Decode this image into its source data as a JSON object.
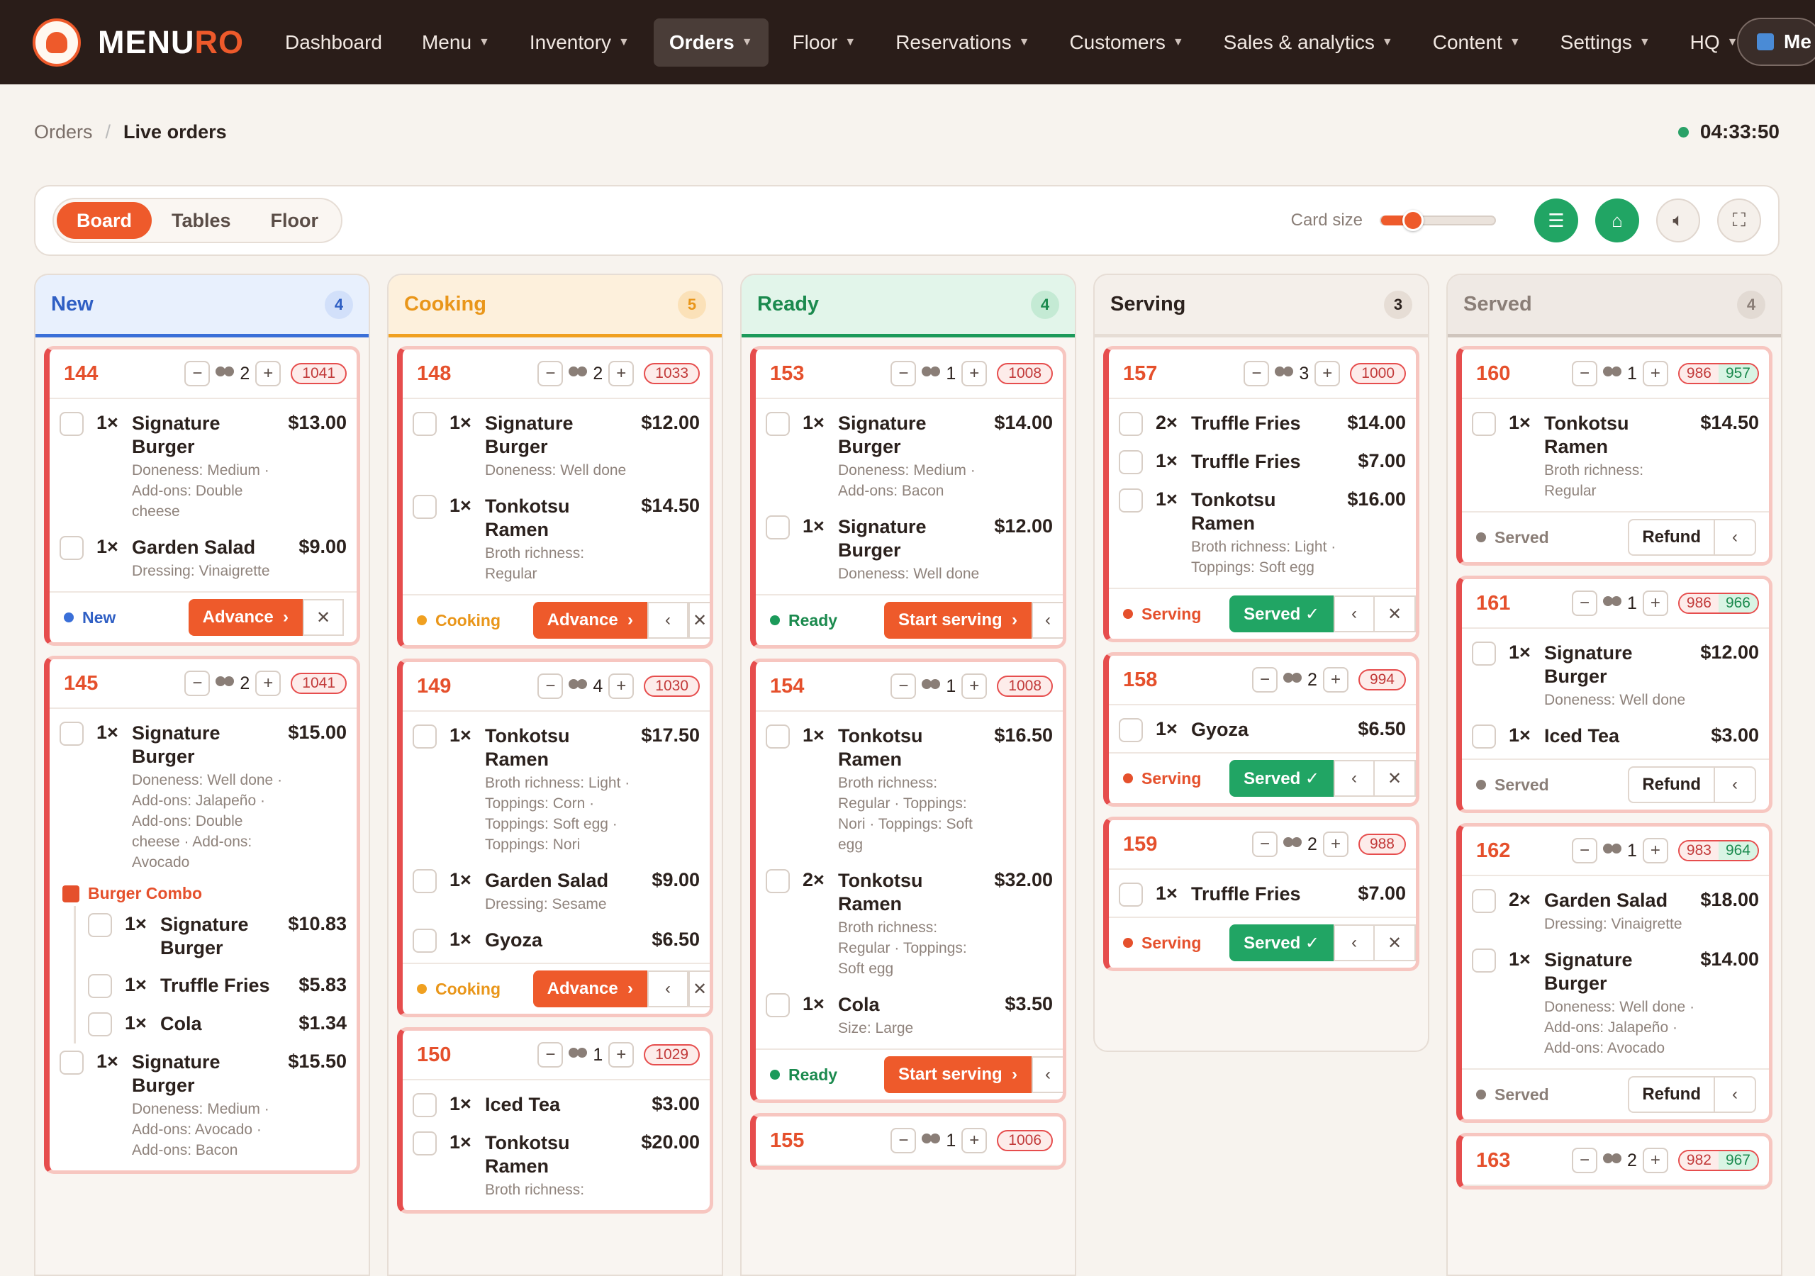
{
  "brand": {
    "name_main": "MENU",
    "name_accent": "RO"
  },
  "nav": {
    "items": [
      "Dashboard",
      "Menu",
      "Inventory",
      "Orders",
      "Floor",
      "Reservations",
      "Customers",
      "Sales & analytics",
      "Content",
      "Settings",
      "HQ"
    ],
    "active": "Orders",
    "hq_switch_label": "Me"
  },
  "breadcrumb": {
    "parent": "Orders",
    "separator": "/",
    "current": "Live orders"
  },
  "clock": "04:33:50",
  "toolbar": {
    "views": [
      "Board",
      "Tables",
      "Floor"
    ],
    "active_view": "Board",
    "card_size_label": "Card size",
    "card_size_value": 0.28
  },
  "columns": [
    {
      "title": "New",
      "count": "4",
      "color": "#3a6fd8"
    },
    {
      "title": "Cooking",
      "count": "5",
      "color": "#f0a020"
    },
    {
      "title": "Ready",
      "count": "4",
      "color": "#1b9a5a"
    },
    {
      "title": "Serving",
      "count": "3",
      "color": "#2b211d"
    },
    {
      "title": "Served",
      "count": "4",
      "color": "#8a7e77"
    }
  ],
  "labels": {
    "advance": "Advance",
    "start_serving": "Start serving",
    "served_btn": "Served ✓",
    "refund": "Refund",
    "status_new": "New",
    "status_cooking": "Cooking",
    "status_ready": "Ready",
    "status_serving": "Serving",
    "status_served": "Served",
    "combo_name": "Burger Combo"
  },
  "orders": {
    "o144": {
      "no": "144",
      "guests": "2",
      "tag": "1041",
      "items": [
        {
          "q": "1×",
          "n": "Signature Burger",
          "m": "Doneness: Medium · Add-ons: Double cheese",
          "p": "$13.00"
        },
        {
          "q": "1×",
          "n": "Garden Salad",
          "m": "Dressing: Vinaigrette",
          "p": "$9.00"
        }
      ]
    },
    "o145": {
      "no": "145",
      "guests": "2",
      "tag": "1041",
      "items": [
        {
          "q": "1×",
          "n": "Signature Burger",
          "m": "Doneness: Well done · Add-ons: Jalapeño · Add-ons: Double cheese · Add-ons: Avocado",
          "p": "$15.00"
        },
        {
          "q": "1×",
          "n": "Signature Burger",
          "m": "",
          "p": "$10.83"
        },
        {
          "q": "1×",
          "n": "Truffle Fries",
          "m": "",
          "p": "$5.83"
        },
        {
          "q": "1×",
          "n": "Cola",
          "m": "",
          "p": "$1.34"
        },
        {
          "q": "1×",
          "n": "Signature Burger",
          "m": "Doneness: Medium · Add-ons: Avocado · Add-ons: Bacon",
          "p": "$15.50"
        }
      ]
    },
    "o148": {
      "no": "148",
      "guests": "2",
      "tag": "1033",
      "items": [
        {
          "q": "1×",
          "n": "Signature Burger",
          "m": "Doneness: Well done",
          "p": "$12.00"
        },
        {
          "q": "1×",
          "n": "Tonkotsu Ramen",
          "m": "Broth richness: Regular",
          "p": "$14.50"
        }
      ]
    },
    "o149": {
      "no": "149",
      "guests": "4",
      "tag": "1030",
      "items": [
        {
          "q": "1×",
          "n": "Tonkotsu Ramen",
          "m": "Broth richness: Light · Toppings: Corn · Toppings: Soft egg · Toppings: Nori",
          "p": "$17.50"
        },
        {
          "q": "1×",
          "n": "Garden Salad",
          "m": "Dressing: Sesame",
          "p": "$9.00"
        },
        {
          "q": "1×",
          "n": "Gyoza",
          "m": "",
          "p": "$6.50"
        }
      ]
    },
    "o150": {
      "no": "150",
      "guests": "1",
      "tag": "1029",
      "items": [
        {
          "q": "1×",
          "n": "Iced Tea",
          "m": "",
          "p": "$3.00"
        },
        {
          "q": "1×",
          "n": "Tonkotsu Ramen",
          "m": "Broth richness:",
          "p": "$20.00"
        }
      ]
    },
    "o153": {
      "no": "153",
      "guests": "1",
      "tag": "1008",
      "items": [
        {
          "q": "1×",
          "n": "Signature Burger",
          "m": "Doneness: Medium · Add-ons: Bacon",
          "p": "$14.00"
        },
        {
          "q": "1×",
          "n": "Signature Burger",
          "m": "Doneness: Well done",
          "p": "$12.00"
        }
      ]
    },
    "o154": {
      "no": "154",
      "guests": "1",
      "tag": "1008",
      "items": [
        {
          "q": "1×",
          "n": "Tonkotsu Ramen",
          "m": "Broth richness: Regular · Toppings: Nori · Toppings: Soft egg",
          "p": "$16.50"
        },
        {
          "q": "2×",
          "n": "Tonkotsu Ramen",
          "m": "Broth richness: Regular · Toppings: Soft egg",
          "p": "$32.00"
        },
        {
          "q": "1×",
          "n": "Cola",
          "m": "Size: Large",
          "p": "$3.50"
        }
      ]
    },
    "o155": {
      "no": "155",
      "guests": "1",
      "tag": "1006"
    },
    "o157": {
      "no": "157",
      "guests": "3",
      "tag": "1000",
      "items": [
        {
          "q": "2×",
          "n": "Truffle Fries",
          "m": "",
          "p": "$14.00"
        },
        {
          "q": "1×",
          "n": "Truffle Fries",
          "m": "",
          "p": "$7.00"
        },
        {
          "q": "1×",
          "n": "Tonkotsu Ramen",
          "m": "Broth richness: Light · Toppings: Soft egg",
          "p": "$16.00"
        }
      ]
    },
    "o158": {
      "no": "158",
      "guests": "2",
      "tag": "994",
      "items": [
        {
          "q": "1×",
          "n": "Gyoza",
          "m": "",
          "p": "$6.50"
        }
      ]
    },
    "o159": {
      "no": "159",
      "guests": "2",
      "tag": "988",
      "items": [
        {
          "q": "1×",
          "n": "Truffle Fries",
          "m": "",
          "p": "$7.00"
        }
      ]
    },
    "o160": {
      "no": "160",
      "guests": "1",
      "tag_a": "986",
      "tag_b": "957",
      "items": [
        {
          "q": "1×",
          "n": "Tonkotsu Ramen",
          "m": "Broth richness: Regular",
          "p": "$14.50"
        }
      ]
    },
    "o161": {
      "no": "161",
      "guests": "1",
      "tag_a": "986",
      "tag_b": "966",
      "items": [
        {
          "q": "1×",
          "n": "Signature Burger",
          "m": "Doneness: Well done",
          "p": "$12.00"
        },
        {
          "q": "1×",
          "n": "Iced Tea",
          "m": "",
          "p": "$3.00"
        }
      ]
    },
    "o162": {
      "no": "162",
      "guests": "1",
      "tag_a": "983",
      "tag_b": "964",
      "items": [
        {
          "q": "2×",
          "n": "Garden Salad",
          "m": "Dressing: Vinaigrette",
          "p": "$18.00"
        },
        {
          "q": "1×",
          "n": "Signature Burger",
          "m": "Doneness: Well done · Add-ons: Jalapeño · Add-ons: Avocado",
          "p": "$14.00"
        }
      ]
    },
    "o163": {
      "no": "163",
      "guests": "2",
      "tag_a": "982",
      "tag_b": "967"
    }
  }
}
